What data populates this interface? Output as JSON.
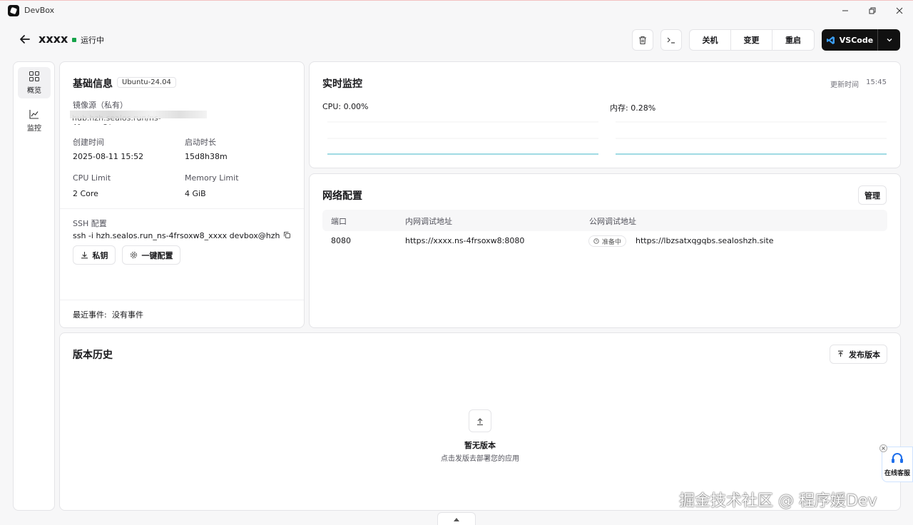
{
  "app": {
    "title": "DevBox"
  },
  "header": {
    "name": "xxxx",
    "status": "运行中",
    "buttons": {
      "shutdown": "关机",
      "change": "变更",
      "restart": "重启",
      "vscode": "VSCode"
    }
  },
  "sidebar": {
    "items": [
      {
        "label": "概览",
        "active": true
      },
      {
        "label": "监控",
        "active": false
      }
    ]
  },
  "basic": {
    "title": "基础信息",
    "os": "Ubuntu-24.04",
    "image_label": "镜像源（私有）",
    "image_value": "hub.hzh.sealos.run/ns-4frsoxw8/xxxx",
    "created_label": "创建时间",
    "created_value": "2025-08-11 15:52",
    "uptime_label": "启动时长",
    "uptime_value": "15d8h38m",
    "cpu_label": "CPU Limit",
    "cpu_value": "2 Core",
    "mem_label": "Memory Limit",
    "mem_value": "4 GiB",
    "ssh_label": "SSH 配置",
    "ssh_value": "ssh -i hzh.sealos.run_ns-4frsoxw8_xxxx devbox@hzh.se...",
    "private_key_btn": "私钥",
    "one_click_btn": "一键配置",
    "events_label": "最近事件:",
    "events_value": "没有事件"
  },
  "monitor": {
    "title": "实时监控",
    "update_label": "更新时间",
    "update_time": "15:45",
    "cpu_label": "CPU: 0.00%",
    "mem_label": "内存: 0.28%",
    "line_color": "#67c5d4"
  },
  "network": {
    "title": "网络配置",
    "manage_btn": "管理",
    "columns": [
      "端口",
      "内网调试地址",
      "公网调试地址"
    ],
    "rows": [
      {
        "port": "8080",
        "internal": "https://xxxx.ns-4frsoxw8:8080",
        "status": "准备中",
        "public": "https://lbzsatxqgqbs.sealoshzh.site"
      }
    ]
  },
  "history": {
    "title": "版本历史",
    "publish_btn": "发布版本",
    "empty_title": "暂无版本",
    "empty_desc": "点击发版去部署您的应用"
  },
  "support": {
    "label": "在线客服"
  },
  "watermark": "掘金技术社区 @ 程序媛Dev"
}
